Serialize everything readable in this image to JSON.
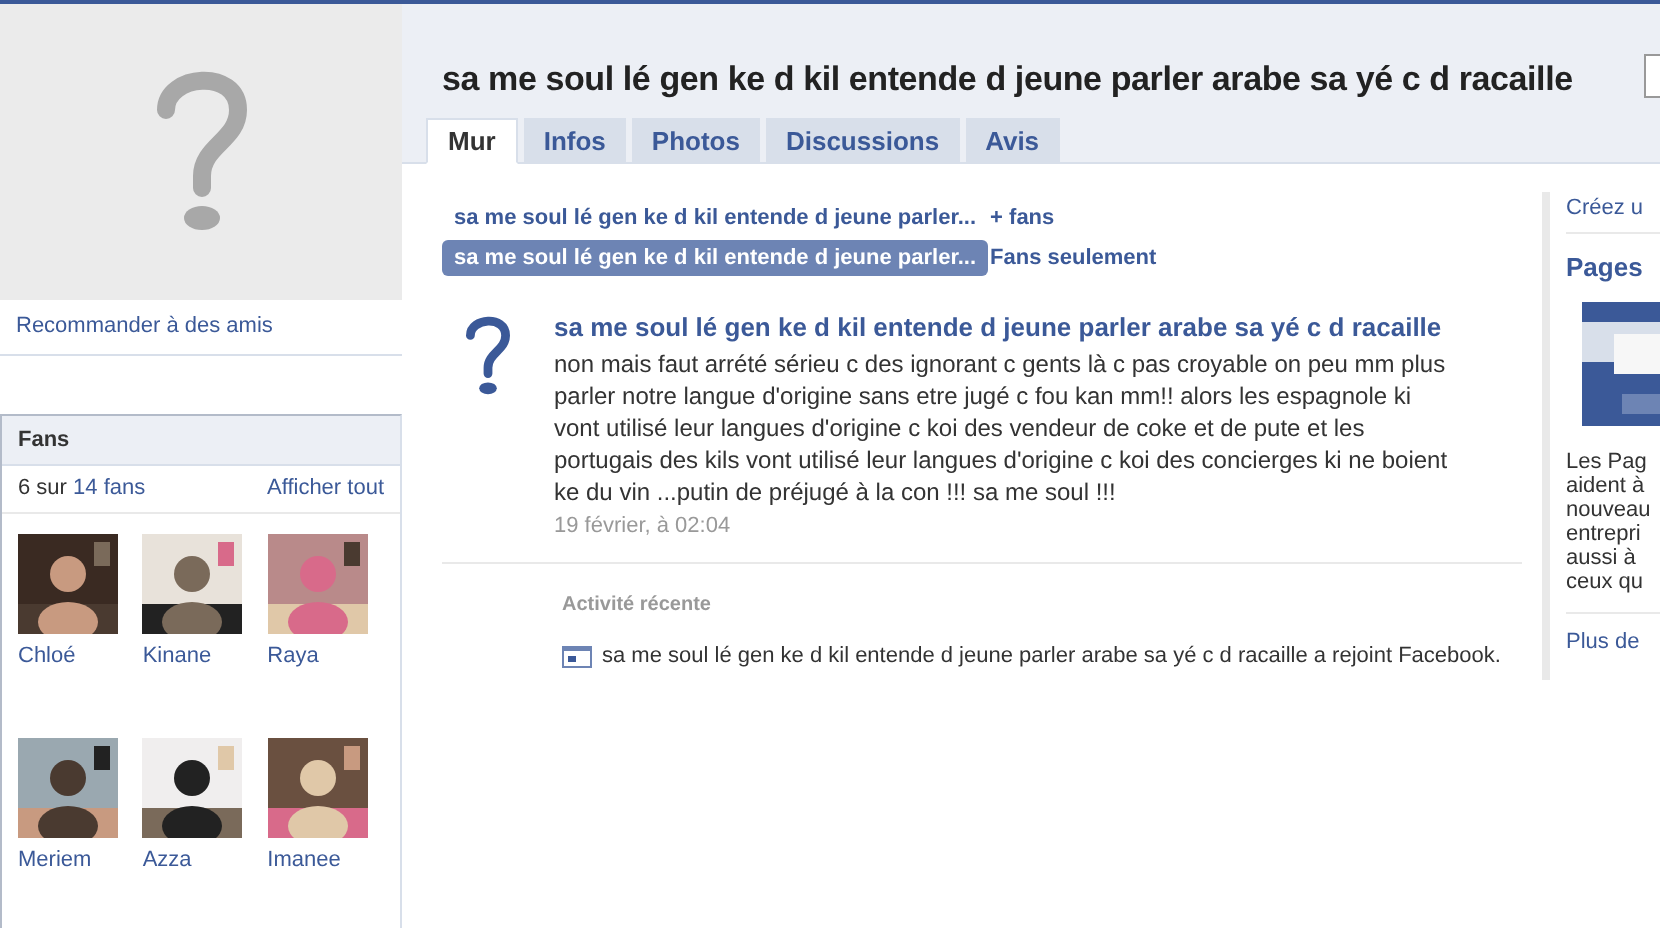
{
  "profile": {
    "recommend_link": "Recommander à des amis"
  },
  "fans": {
    "title": "Fans",
    "count_prefix": "6 sur",
    "count_link": "14 fans",
    "see_all": "Afficher tout",
    "items": [
      {
        "name": "Chloé",
        "kind": "picture"
      },
      {
        "name": "Kinane",
        "kind": "picture"
      },
      {
        "name": "Raya",
        "kind": "picture"
      },
      {
        "name": "Meriem",
        "kind": "picture"
      },
      {
        "name": "Azza",
        "kind": "picture"
      },
      {
        "name": "Imanee",
        "kind": "picture"
      }
    ]
  },
  "page_title": "sa me soul lé gen ke d kil entende d jeune parler arabe sa yé c d racaille",
  "tabs": [
    {
      "label": "Mur",
      "selected": true
    },
    {
      "label": "Infos",
      "selected": false
    },
    {
      "label": "Photos",
      "selected": false
    },
    {
      "label": "Discussions",
      "selected": false
    },
    {
      "label": "Avis",
      "selected": false
    }
  ],
  "filters": [
    {
      "label": "sa me soul lé gen ke d kil entende d jeune parler...",
      "suffix": "+ fans",
      "selected": false
    },
    {
      "label": "sa me soul lé gen ke d kil entende d jeune parler...",
      "suffix": "Fans seulement",
      "selected": true
    }
  ],
  "post": {
    "author": "sa me soul lé gen ke d kil entende d jeune parler arabe sa yé c d racaille",
    "text": "non mais faut arrété sérieu c des ignorant c gents là c pas croyable on peu mm plus parler notre langue d'origine sans etre jugé c fou kan mm!! alors les espagnole ki vont utilisé leur langues d'origine c koi des vendeur de coke et de pute et les portugais des kils vont utilisé leur langues d'origine c koi des concierges ki ne boient ke du vin ...putin de préjugé à la con !!! sa me soul !!!",
    "time": "19 février, à 02:04"
  },
  "recent_activity": {
    "title": "Activité récente",
    "items": [
      "sa me soul lé gen ke d kil entende d jeune parler arabe sa yé c d racaille a rejoint Facebook."
    ]
  },
  "right_column": {
    "create_link": "Créez u",
    "heading": "Pages",
    "lines": [
      "Les Pag",
      "aident à",
      "nouveau",
      "entrepri",
      "aussi à",
      "ceux qu"
    ],
    "more_link": "Plus de"
  }
}
